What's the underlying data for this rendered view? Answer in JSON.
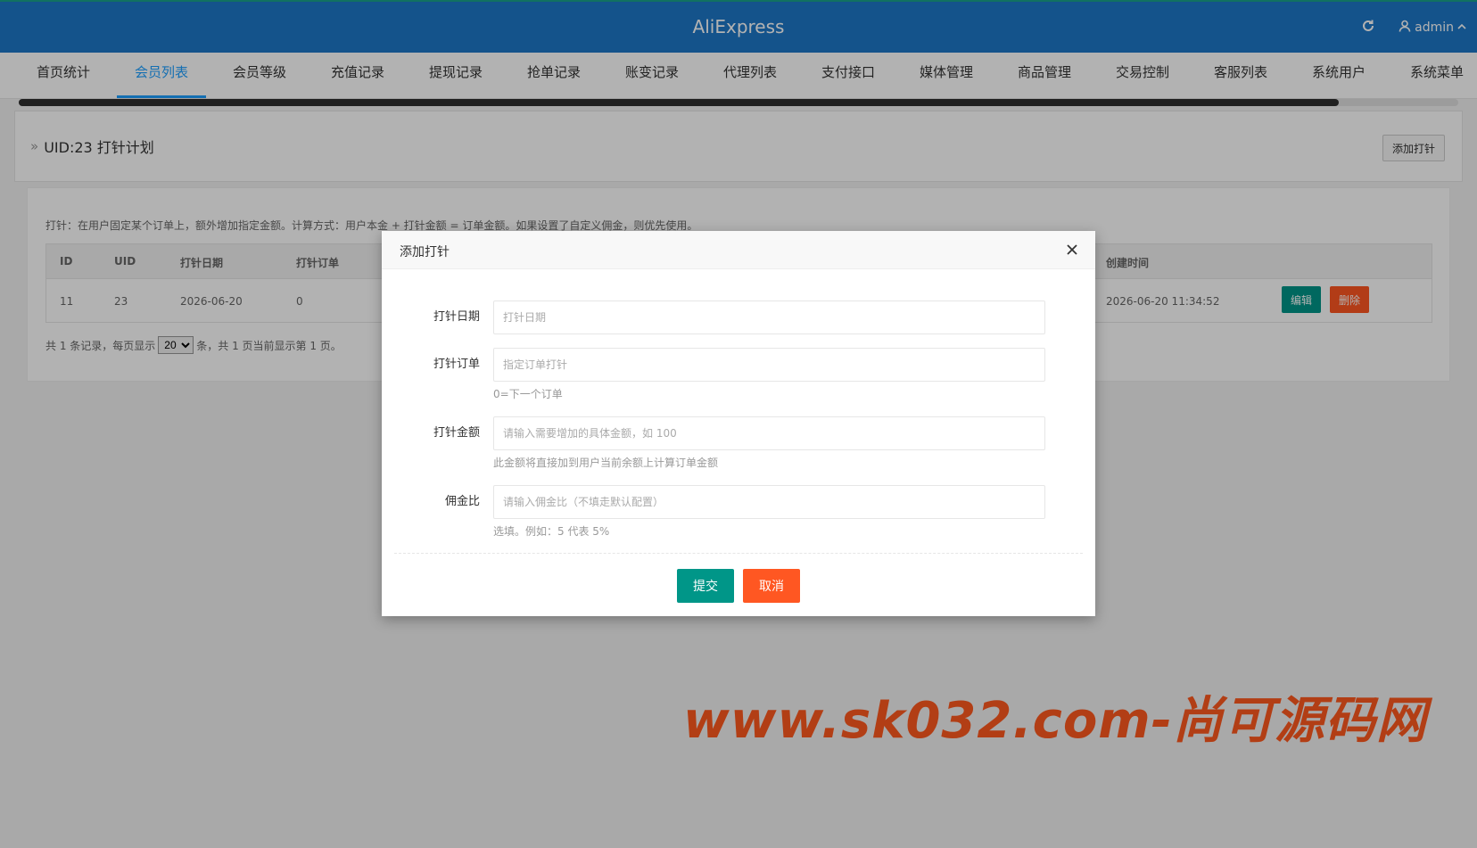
{
  "header": {
    "brand": "AliExpress",
    "user": "admin",
    "refresh_icon": "refresh-icon",
    "user_icon": "user-icon"
  },
  "nav": {
    "items": [
      "首页统计",
      "会员列表",
      "会员等级",
      "充值记录",
      "提现记录",
      "抢单记录",
      "账变记录",
      "代理列表",
      "支付接口",
      "媒体管理",
      "商品管理",
      "交易控制",
      "客服列表",
      "系统用户",
      "系统菜单"
    ],
    "active": "会员列表"
  },
  "page": {
    "title": "UID:23 打针计划",
    "add_button": "添加打针"
  },
  "content": {
    "tip": "打针：在用户固定某个订单上，额外增加指定金额。计算方式：用户本金 + 打针金额 = 订单金额。如果设置了自定义佣金，则优先使用。",
    "table": {
      "headers": [
        "ID",
        "UID",
        "打针日期",
        "打针订单",
        "创建时间"
      ],
      "rows": [
        {
          "id": "11",
          "uid": "23",
          "date": "2026-06-20",
          "order": "0",
          "created": "2026-06-20 11:34:52"
        }
      ],
      "edit_label": "编辑",
      "delete_label": "删除"
    },
    "pager": {
      "prefix": "共 1 条记录，每页显示",
      "per_page": "20",
      "suffix": "条，共 1 页当前显示第 1 页。"
    }
  },
  "modal": {
    "title": "添加打针",
    "fields": [
      {
        "label": "打针日期",
        "placeholder": "打针日期",
        "value": "",
        "hint": ""
      },
      {
        "label": "打针订单",
        "placeholder": "指定订单打针",
        "value": "",
        "hint": "0=下一个订单"
      },
      {
        "label": "打针金额",
        "placeholder": "请输入需要增加的具体金额，如 100",
        "value": "",
        "hint": "此金额将直接加到用户当前余额上计算订单金额"
      },
      {
        "label": "佣金比",
        "placeholder": "请输入佣金比（不填走默认配置）",
        "value": "",
        "hint": "选填。例如：5 代表 5%"
      }
    ],
    "submit": "提交",
    "cancel": "取消"
  },
  "watermark": "www.sk032.com-尚可源码网",
  "colors": {
    "header_bg": "#1e78c8",
    "active_tab": "#1e9fff",
    "primary_btn": "#009688",
    "danger_btn": "#ff5722",
    "watermark": "#ff5a1f"
  }
}
